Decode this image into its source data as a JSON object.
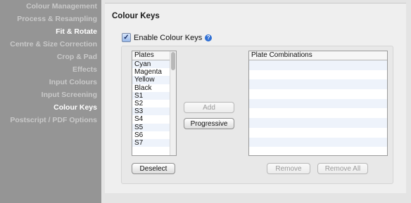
{
  "sidebar": {
    "items": [
      {
        "label": "Colour Management",
        "highlight": false
      },
      {
        "label": "Process & Resampling",
        "highlight": false
      },
      {
        "label": "Fit & Rotate",
        "highlight": true
      },
      {
        "label": "Centre & Size Correction",
        "highlight": false
      },
      {
        "label": "Crop & Pad",
        "highlight": false
      },
      {
        "label": "Effects",
        "highlight": false
      },
      {
        "label": "Input Colours",
        "highlight": false
      },
      {
        "label": "Input Screening",
        "highlight": false
      },
      {
        "label": "Colour Keys",
        "highlight": true
      },
      {
        "label": "Postscript / PDF Options",
        "highlight": false
      }
    ]
  },
  "panel": {
    "title": "Colour Keys",
    "enable_label": "Enable Colour Keys",
    "enable_checked": true,
    "help_icon": "question-circle-icon",
    "check_glyph": "✓",
    "help_glyph": "?"
  },
  "plates": {
    "header": "Plates",
    "items": [
      "Cyan",
      "Magenta",
      "Yellow",
      "Black",
      "S1",
      "S2",
      "S3",
      "S4",
      "S5",
      "S6",
      "S7"
    ]
  },
  "combinations": {
    "header": "Plate Combinations"
  },
  "buttons": {
    "add": "Add",
    "progressive": "Progressive",
    "deselect": "Deselect",
    "remove": "Remove",
    "remove_all": "Remove All"
  },
  "colors": {
    "sidebar_bg": "#959595",
    "sidebar_text": "#c9c9c9",
    "sidebar_highlight_text": "#ffffff",
    "row_alt": "#eef3fb"
  }
}
